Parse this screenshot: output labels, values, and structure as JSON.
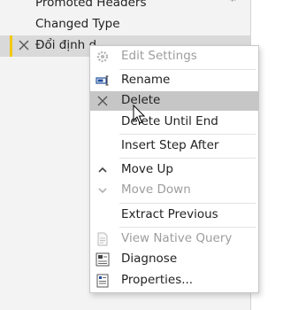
{
  "applied_steps": [
    {
      "label": "Promoted Headers",
      "has_gear": true
    },
    {
      "label": "Changed Type"
    },
    {
      "label": "Đổi định d...",
      "selected": true
    }
  ],
  "context_menu": {
    "items": [
      {
        "label": "Edit Settings",
        "icon": "gear-icon",
        "disabled": true
      },
      {
        "label": "Rename",
        "icon": "rename-icon"
      },
      {
        "label": "Delete",
        "icon": "close-icon",
        "hover": true
      },
      {
        "label": "Delete Until End",
        "icon": ""
      },
      {
        "label": "Insert Step After",
        "icon": ""
      },
      {
        "label": "Move Up",
        "icon": "chevron-up-icon"
      },
      {
        "label": "Move Down",
        "icon": "chevron-down-icon",
        "disabled": true
      },
      {
        "label": "Extract Previous",
        "icon": ""
      },
      {
        "label": "View Native Query",
        "icon": "document-icon",
        "disabled": true
      },
      {
        "label": "Diagnose",
        "icon": "diagnose-icon"
      },
      {
        "label": "Properties...",
        "icon": "properties-icon"
      }
    ]
  },
  "colors": {
    "selected_accent": "#f2c811",
    "hover_bg": "#c6c6c6",
    "disabled_text": "#9d9d9d"
  }
}
